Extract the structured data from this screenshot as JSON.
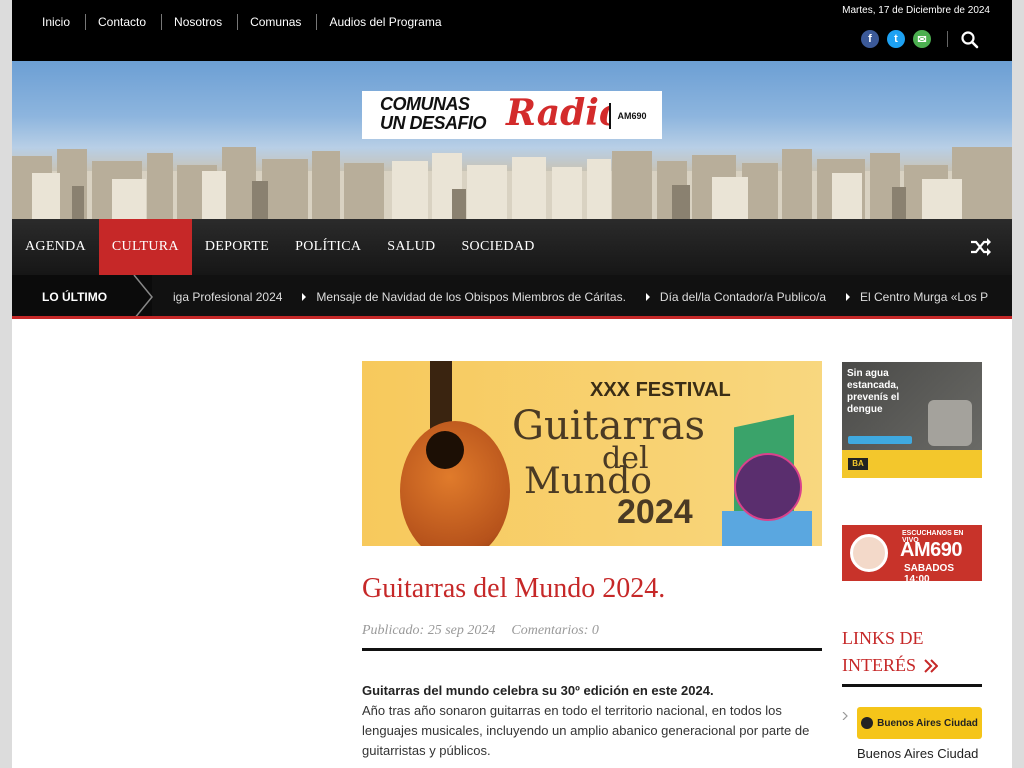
{
  "topnav": [
    "Inicio",
    "Contacto",
    "Nosotros",
    "Comunas",
    "Audios del Programa"
  ],
  "date": "Martes, 17 de Diciembre de 2024",
  "social": {
    "facebook": "f",
    "twitter": "t",
    "email": "✉"
  },
  "logo": {
    "line1": "COMUNAS",
    "line2": "UN DESAFIO",
    "radio": "Radio",
    "freq": "AM690"
  },
  "mainnav": [
    "AGENDA",
    "CULTURA",
    "DEPORTE",
    "POLÍTICA",
    "SALUD",
    "SOCIEDAD"
  ],
  "mainnav_active": "CULTURA",
  "ticker": {
    "label": "LO ÚLTIMO",
    "items": [
      "iga Profesional 2024",
      "Mensaje de Navidad de los Obispos Miembros de Cáritas.",
      "Día del/la Contador/a Publico/a",
      "El Centro Murga «Los P"
    ]
  },
  "feature": {
    "line1": "XXX  FESTIVAL",
    "line2": "Guitarras",
    "line3": "del",
    "line4": "Mundo",
    "line5": "2024"
  },
  "article": {
    "title": "Guitarras del Mundo 2024.",
    "published": "Publicado: 25 sep 2024",
    "comments": "Comentarios: 0",
    "lead": "Guitarras del mundo celebra su 30º edición en este 2024.",
    "paragraph": "Año tras año sonaron guitarras en todo el territorio nacional, en todos los lenguajes musicales, incluyendo un amplio abanico generacional por parte de guitarristas y públicos."
  },
  "sidebar": {
    "ad1_text": "Sin agua estancada, prevenís el dengue",
    "ad1_ba": "BA",
    "ad2_top": "ESCUCHANOS EN VIVO",
    "ad2_freq": "AM690",
    "ad2_time": "SABADOS 14:00",
    "links_title_1": "LINKS DE",
    "links_title_2": "INTERÉS",
    "link1_logo": "Buenos Aires Ciudad",
    "link1_label": "Buenos Aires Ciudad"
  },
  "colors": {
    "accent": "#c62828",
    "facebook": "#3b5998",
    "twitter": "#1da1f2",
    "email": "#4caf50"
  }
}
